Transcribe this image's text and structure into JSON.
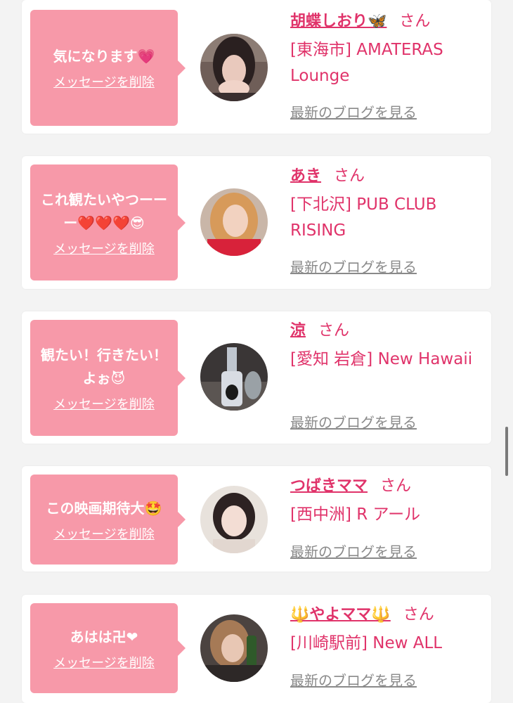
{
  "delete_label": "メッセージを削除",
  "blog_label": "最新のブログを見る",
  "honorific": "さん",
  "colors": {
    "accent_pink": "#e0336a",
    "bubble_pink": "#f799a9",
    "link_gray": "#8a8a8a",
    "card_bg": "#ffffff",
    "page_bg": "#f3f3f3"
  },
  "messages": [
    {
      "bubble_text": "気になります💗",
      "name": "胡蝶しおり🦋",
      "shop": "[東海市] AMATERAS Lounge"
    },
    {
      "bubble_text": "これ観たいやつーーー❤️❤️❤️😎",
      "name": "あき",
      "shop": "[下北沢] PUB CLUB RISING"
    },
    {
      "bubble_text": "観たい！行きたい！よぉ😈",
      "name": "涼",
      "shop": "[愛知 岩倉] New Hawaii"
    },
    {
      "bubble_text": "この映画期待大🤩",
      "name": "つばきママ",
      "shop": "[西中洲] R アール"
    },
    {
      "bubble_text": "あはは卍❤",
      "name": "🔱やよママ🔱",
      "shop": "[川崎駅前] New ALL"
    }
  ]
}
